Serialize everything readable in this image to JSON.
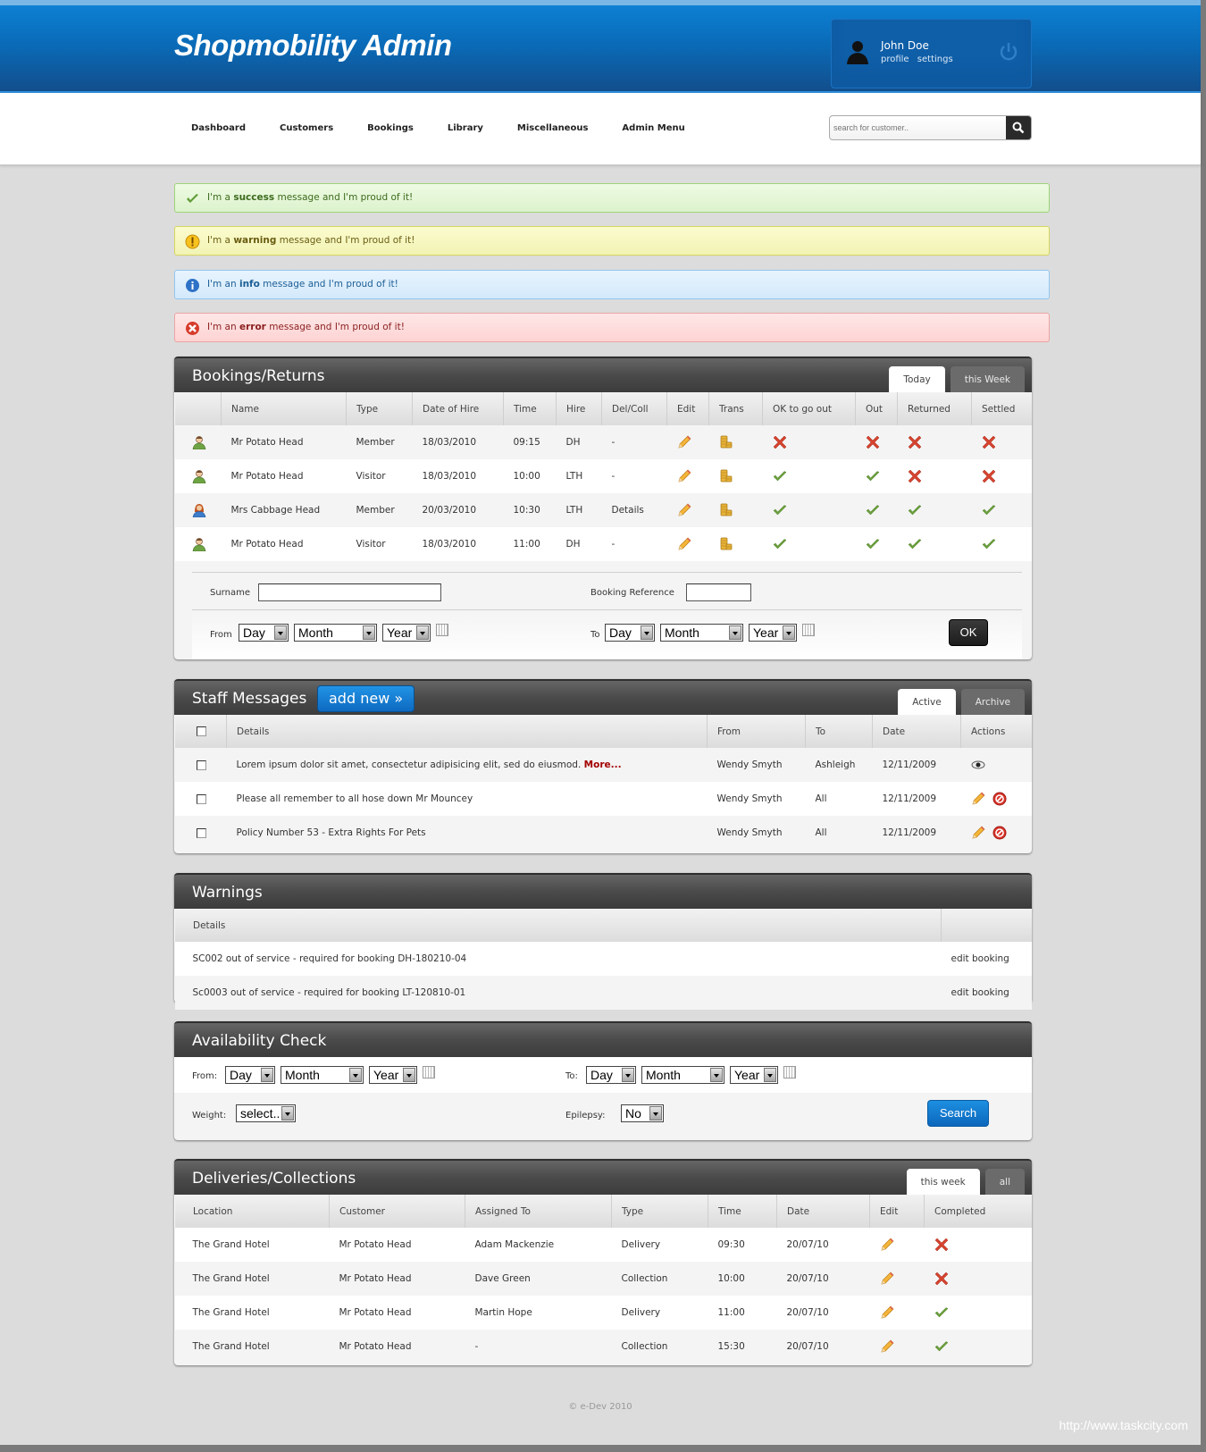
{
  "header": {
    "brand": "Shopmobility Admin",
    "user": {
      "name": "John Doe",
      "links": [
        "profile",
        "settings"
      ]
    },
    "icons": {
      "avatar": "user-silhouette-icon",
      "logout": "power-icon"
    }
  },
  "nav": {
    "items": [
      "Dashboard",
      "Customers",
      "Bookings",
      "Library",
      "Miscellaneous",
      "Admin Menu"
    ],
    "search": {
      "placeholder": "search for customer..",
      "value": "",
      "icon": "magnifier-icon"
    }
  },
  "messages": [
    {
      "type": "success",
      "prefix": "I'm a ",
      "keyword": "success",
      "suffix": " message and I'm proud of it!",
      "icon": "check-icon"
    },
    {
      "type": "warning",
      "prefix": "I'm a ",
      "keyword": "warning",
      "suffix": " message and I'm proud of it!",
      "icon": "exclamation-icon"
    },
    {
      "type": "info",
      "prefix": "I'm an ",
      "keyword": "info",
      "suffix": " message and I'm proud of it!",
      "icon": "info-icon"
    },
    {
      "type": "error",
      "prefix": "I'm an ",
      "keyword": "error",
      "suffix": " message and I'm proud of it!",
      "icon": "error-x-icon"
    }
  ],
  "bookings": {
    "title": "Bookings/Returns",
    "tabs": [
      {
        "label": "Today",
        "active": true
      },
      {
        "label": "this Week",
        "active": false
      }
    ],
    "columns": [
      "",
      "Name",
      "Type",
      "Date of Hire",
      "Time",
      "Hire",
      "Del/Coll",
      "Edit",
      "Trans",
      "OK to go out",
      "Out",
      "Returned",
      "Settled"
    ],
    "rows": [
      {
        "gender": "male",
        "name": "Mr Potato Head",
        "type": "Member",
        "date": "18/03/2010",
        "time": "09:15",
        "hire": "DH",
        "delcoll": "-",
        "ok": false,
        "out": false,
        "returned": false,
        "settled": false
      },
      {
        "gender": "male",
        "name": "Mr Potato Head",
        "type": "Visitor",
        "date": "18/03/2010",
        "time": "10:00",
        "hire": "LTH",
        "delcoll": "-",
        "ok": true,
        "out": true,
        "returned": false,
        "settled": false
      },
      {
        "gender": "female",
        "name": "Mrs Cabbage Head",
        "type": "Member",
        "date": "20/03/2010",
        "time": "10:30",
        "hire": "LTH",
        "delcoll": "Details",
        "ok": true,
        "out": true,
        "returned": true,
        "settled": true
      },
      {
        "gender": "male",
        "name": "Mr Potato Head",
        "type": "Visitor",
        "date": "18/03/2010",
        "time": "11:00",
        "hire": "DH",
        "delcoll": "-",
        "ok": true,
        "out": true,
        "returned": true,
        "settled": true
      }
    ],
    "filter": {
      "surname_label": "Surname",
      "surname_value": "",
      "ref_label": "Booking Reference",
      "ref_value": "",
      "from_label": "From",
      "to_label": "To",
      "day": "Day",
      "month": "Month",
      "year": "Year",
      "ok_label": "OK"
    }
  },
  "staff": {
    "title": "Staff Messages",
    "add_label": "add new »",
    "tabs": [
      {
        "label": "Active",
        "active": true
      },
      {
        "label": "Archive",
        "active": false
      }
    ],
    "columns": [
      "",
      "Details",
      "From",
      "To",
      "Date",
      "Actions"
    ],
    "rows": [
      {
        "details": "Lorem ipsum dolor sit amet, consectetur adipisicing elit, sed do eiusmod.",
        "more": "More...",
        "from": "Wendy Smyth",
        "to": "Ashleigh",
        "date": "12/11/2009",
        "actions": [
          "view"
        ]
      },
      {
        "details": "Please all remember to all hose down Mr Mouncey",
        "more": "",
        "from": "Wendy Smyth",
        "to": "All",
        "date": "12/11/2009",
        "actions": [
          "edit",
          "delete"
        ]
      },
      {
        "details": "Policy Number 53 - Extra Rights For Pets",
        "more": "",
        "from": "Wendy Smyth",
        "to": "All",
        "date": "12/11/2009",
        "actions": [
          "edit",
          "delete"
        ]
      }
    ]
  },
  "warnings": {
    "title": "Warnings",
    "columns": [
      "Details",
      ""
    ],
    "rows": [
      {
        "details": "SC002 out of service - required for booking DH-180210-04",
        "action": "edit booking"
      },
      {
        "details": "Sc0003 out of service - required for booking LT-120810-01",
        "action": "edit booking"
      }
    ]
  },
  "availability": {
    "title": "Availability Check",
    "from_label": "From:",
    "to_label": "To:",
    "day": "Day",
    "month": "Month",
    "year": "Year",
    "weight_label": "Weight:",
    "weight_value": "select..",
    "epilepsy_label": "Epilepsy:",
    "epilepsy_value": "No",
    "search_label": "Search"
  },
  "deliveries": {
    "title": "Deliveries/Collections",
    "tabs": [
      {
        "label": "this week",
        "active": true
      },
      {
        "label": "all",
        "active": false
      }
    ],
    "columns": [
      "Location",
      "Customer",
      "Assigned To",
      "Type",
      "Time",
      "Date",
      "Edit",
      "Completed"
    ],
    "rows": [
      {
        "location": "The Grand Hotel",
        "customer": "Mr Potato Head",
        "assigned": "Adam Mackenzie",
        "type": "Delivery",
        "time": "09:30",
        "date": "20/07/10",
        "completed": false
      },
      {
        "location": "The Grand Hotel",
        "customer": "Mr Potato Head",
        "assigned": "Dave Green",
        "type": "Collection",
        "time": "10:00",
        "date": "20/07/10",
        "completed": false
      },
      {
        "location": "The Grand Hotel",
        "customer": "Mr Potato Head",
        "assigned": "Martin Hope",
        "type": "Delivery",
        "time": "11:00",
        "date": "20/07/10",
        "completed": true
      },
      {
        "location": "The Grand Hotel",
        "customer": "Mr Potato Head",
        "assigned": "-",
        "type": "Collection",
        "time": "15:30",
        "date": "20/07/10",
        "completed": true
      }
    ]
  },
  "footer": {
    "copyright": "© e-Dev 2010",
    "watermark": "http://www.taskcity.com"
  }
}
